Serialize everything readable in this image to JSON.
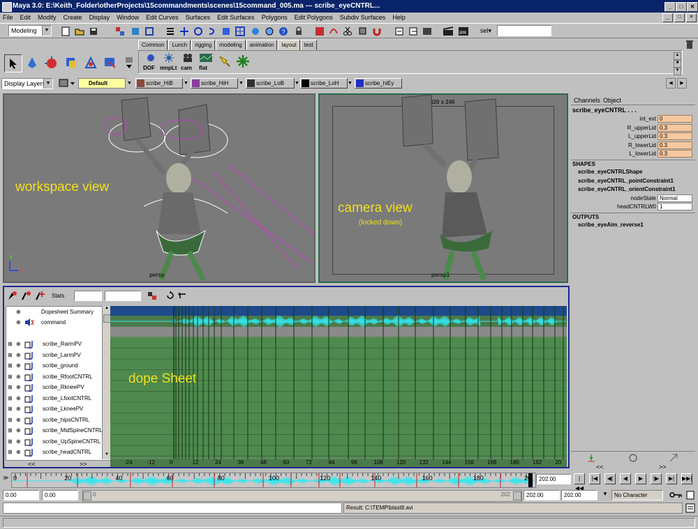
{
  "window": {
    "title": "Maya 3.0: E:\\Keith_Folder\\otherProjects\\15commandments\\scenes\\15command_005.ma   ---   scribe_eyeCNTRL...",
    "min": "_",
    "max": "□",
    "close": "✕"
  },
  "menu": [
    "File",
    "Edit",
    "Modify",
    "Create",
    "Display",
    "Window",
    "Edit Curves",
    "Surfaces",
    "Edit Surfaces",
    "Polygons",
    "Edit Polygons",
    "Subdiv Surfaces",
    "Help"
  ],
  "statusline": {
    "mode": "Modeling",
    "sel_label": "sel▾",
    "sel_value": ""
  },
  "shelf": {
    "tabs": [
      "Common",
      "Lunch",
      "rigging",
      "modeling",
      "animation",
      "layout",
      "test"
    ],
    "active": "layout",
    "buttons": [
      {
        "label": "DOF",
        "icon": "dof-icon"
      },
      {
        "label": "mnpLt",
        "icon": "manip-light-icon"
      },
      {
        "label": "cam",
        "icon": "camera-icon"
      },
      {
        "label": "flat",
        "icon": "flat-shade-icon"
      },
      {
        "label": "",
        "icon": "spotlight-icon"
      },
      {
        "label": "",
        "icon": "star-icon"
      }
    ]
  },
  "layers": {
    "dropdown": "Display Layers",
    "default": "Default",
    "items": [
      {
        "name": "scribe_HiB",
        "color": "#8a4a3a"
      },
      {
        "name": "scribe_HiH",
        "color": "#8a3aa0"
      },
      {
        "name": "scribe_LoB",
        "color": "#303030"
      },
      {
        "name": "scribe_LoH",
        "color": "#000000"
      },
      {
        "name": "scribe_hiEy",
        "color": "#2030c0"
      }
    ]
  },
  "viewports": {
    "left": {
      "annotation": "workspace view",
      "camera": "persp"
    },
    "right": {
      "annotation": "camera view",
      "annotation_sub": "(locked down)",
      "resolution": "320 x 240",
      "camera": "persp1"
    }
  },
  "channelbox": {
    "tabs": [
      "Channels",
      "Object"
    ],
    "object": "scribe_eyeCNTRL . . .",
    "channels": [
      {
        "name": "int_ext",
        "value": "0"
      },
      {
        "name": "R_upperLid",
        "value": "0.3"
      },
      {
        "name": "L_upperLid",
        "value": "0.3"
      },
      {
        "name": "R_lowerLid",
        "value": "0.3"
      },
      {
        "name": "L_lowerLid",
        "value": "0.3"
      }
    ],
    "shapes_label": "SHAPES",
    "shapes": [
      "scribe_eyeCNTRLShape",
      "scribe_eyeCNTRL_pointConstraint1",
      "scribe_eyeCNTRL_orientConstraint1"
    ],
    "shape_attrs": [
      {
        "name": "nodeState",
        "value": "Normal"
      },
      {
        "name": "headCNTRLW0",
        "value": "1"
      }
    ],
    "outputs_label": "OUTPUTS",
    "outputs": [
      "scribe_eyeAim_reverse1"
    ]
  },
  "dopesheet": {
    "annotation": "dope Sheet",
    "stats_label": "Stats",
    "summary": "Dopesheet Summary",
    "command": "command",
    "items": [
      "scribe_RarmPV",
      "scribe_LarmPV",
      "scribe_ground",
      "scribe_RfootCNTRL",
      "scribe_RkneePV",
      "scribe_LfootCNTRL",
      "scribe_LkneePV",
      "scribe_hipsCNTRL",
      "scribe_MidSpineCNTRL",
      "scribe_UpSpineCNTRL",
      "scribe_headCNTRL"
    ],
    "ruler": [
      "-24",
      "-12",
      "0",
      "12",
      "24",
      "36",
      "48",
      "60",
      "72",
      "84",
      "96",
      "108",
      "120",
      "132",
      "144",
      "156",
      "168",
      "180",
      "192",
      "20"
    ],
    "scroll_left": "<<",
    "scroll_right": ">>"
  },
  "timeline": {
    "ticks": [
      "0",
      "20",
      "40",
      "60",
      "80",
      "100",
      "120",
      "140",
      "160",
      "180",
      "20"
    ],
    "current": "202.00",
    "range_start": "0.00",
    "play_start": "0.00",
    "range_start_mark": "0",
    "range_end_mark": "202",
    "play_end": "202.00",
    "range_end": "202.00",
    "character": "No Character"
  },
  "cmdline": {
    "result": "Result: C:\\TEMP\\blast8.avi"
  }
}
